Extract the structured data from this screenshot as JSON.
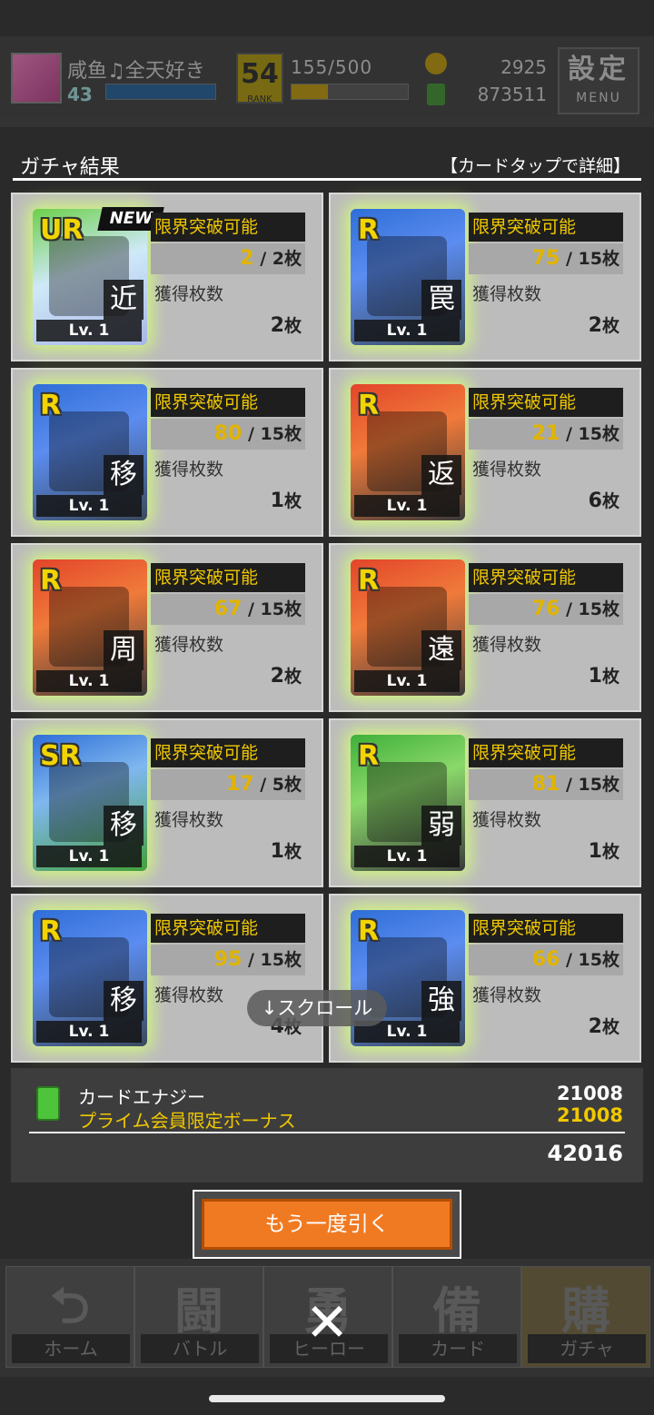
{
  "status": {
    "player_name": "咸鱼♫全天好き",
    "player_level": "43",
    "rank": "54",
    "rank_label": "RANK",
    "stamina": "155/500",
    "gold": "2925",
    "energy": "873511",
    "settings_label": "設定",
    "settings_sub": "MENU"
  },
  "result": {
    "title": "ガチャ結果",
    "hint": "【カードタップで詳細】",
    "limit_label": "限界突破可能",
    "get_label": "獲得枚数",
    "count_unit": "枚",
    "lv_label": "Lv. 1",
    "new_label": "NEW",
    "cards": [
      {
        "rarity": "UR",
        "kind": "近",
        "limit_have": "2",
        "limit_need": "2",
        "got": "2",
        "is_new": true
      },
      {
        "rarity": "R",
        "kind": "罠",
        "limit_have": "75",
        "limit_need": "15",
        "got": "2",
        "is_new": false
      },
      {
        "rarity": "R",
        "kind": "移",
        "limit_have": "80",
        "limit_need": "15",
        "got": "1",
        "is_new": false
      },
      {
        "rarity": "R",
        "kind": "返",
        "limit_have": "21",
        "limit_need": "15",
        "got": "6",
        "is_new": false
      },
      {
        "rarity": "R",
        "kind": "周",
        "limit_have": "67",
        "limit_need": "15",
        "got": "2",
        "is_new": false
      },
      {
        "rarity": "R",
        "kind": "遠",
        "limit_have": "76",
        "limit_need": "15",
        "got": "1",
        "is_new": false
      },
      {
        "rarity": "SR",
        "kind": "移",
        "limit_have": "17",
        "limit_need": "5",
        "got": "1",
        "is_new": false
      },
      {
        "rarity": "R",
        "kind": "弱",
        "limit_have": "81",
        "limit_need": "15",
        "got": "1",
        "is_new": false
      },
      {
        "rarity": "R",
        "kind": "移",
        "limit_have": "95",
        "limit_need": "15",
        "got": "4",
        "is_new": false
      },
      {
        "rarity": "R",
        "kind": "強",
        "limit_have": "66",
        "limit_need": "15",
        "got": "2",
        "is_new": false
      }
    ],
    "scroll_hint": "↓スクロール"
  },
  "summary": {
    "energy_label": "カードエナジー",
    "bonus_label": "プライム会員限定ボーナス",
    "energy_value": "21008",
    "bonus_value": "21008",
    "total": "42016"
  },
  "again_button": "もう一度引く",
  "nav": [
    {
      "glyph": "⮌",
      "label": "ホーム"
    },
    {
      "glyph": "闘",
      "label": "バトル"
    },
    {
      "glyph": "勇",
      "label": "ヒーロー"
    },
    {
      "glyph": "備",
      "label": "カード"
    },
    {
      "glyph": "購",
      "label": "ガチャ"
    }
  ],
  "close_glyph": "✕",
  "colors": {
    "accent_orange": "#f07a22",
    "highlight_yellow": "#f0c800",
    "glow": "#d6ff78"
  }
}
